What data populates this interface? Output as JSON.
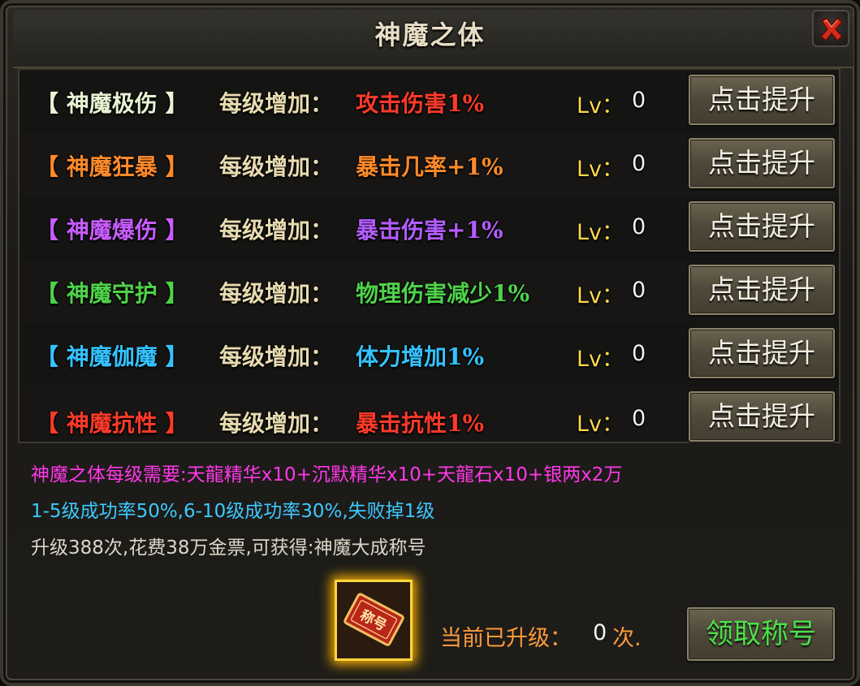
{
  "window": {
    "title": "神魔之体"
  },
  "rows": [
    {
      "name": "【 神魔极伤 】",
      "name_color": "#e8f4d4",
      "label": "每级增加：",
      "effect": "攻击伤害1%",
      "effect_color": "#ff3a2a",
      "lv_label": "Lv：",
      "lv_value": "0",
      "button": "点击提升"
    },
    {
      "name": "【 神魔狂暴 】",
      "name_color": "#ff8a2a",
      "label": "每级增加：",
      "effect": "暴击几率+1%",
      "effect_color": "#ff8a2a",
      "lv_label": "Lv：",
      "lv_value": "0",
      "button": "点击提升"
    },
    {
      "name": "【 神魔爆伤 】",
      "name_color": "#c95cff",
      "label": "每级增加：",
      "effect": "暴击伤害+1%",
      "effect_color": "#b45cff",
      "lv_label": "Lv：",
      "lv_value": "0",
      "button": "点击提升"
    },
    {
      "name": "【 神魔守护 】",
      "name_color": "#4fd24a",
      "label": "每级增加：",
      "effect": "物理伤害减少1%",
      "effect_color": "#4fd24a",
      "lv_label": "Lv：",
      "lv_value": "0",
      "button": "点击提升"
    },
    {
      "name": "【 神魔伽魔 】",
      "name_color": "#35c2ff",
      "label": "每级增加：",
      "effect": "体力增加1%",
      "effect_color": "#35c2ff",
      "lv_label": "Lv：",
      "lv_value": "0",
      "button": "点击提升"
    },
    {
      "name": "【 神魔抗性 】",
      "name_color": "#ff3a2a",
      "label": "每级增加：",
      "effect": "暴击抗性1%",
      "effect_color": "#ff3a2a",
      "lv_label": "Lv：",
      "lv_value": "0",
      "button": "点击提升"
    }
  ],
  "info": {
    "requirement": "神魔之体每级需要:天龍精华x10+沉默精华x10+天龍石x10+银两x2万",
    "success_rate": "1-5级成功率50%,6-10级成功率30%,失败掉1级",
    "reward_info": "升级388次,花费38万金票,可获得:神魔大成称号"
  },
  "footer": {
    "upgraded_label": "当前已升级：",
    "upgraded_value": "0",
    "upgraded_unit": "次.",
    "claim_button": "领取称号",
    "reward_icon": "title-ticket-icon",
    "reward_icon_text": "称号"
  },
  "colors": {
    "requirement": "#ff38e8",
    "success_rate": "#3ec9ff",
    "lv_label": "#ffd84a",
    "claim_text": "#4ae24a",
    "upgraded_label": "#ff9a3c"
  }
}
